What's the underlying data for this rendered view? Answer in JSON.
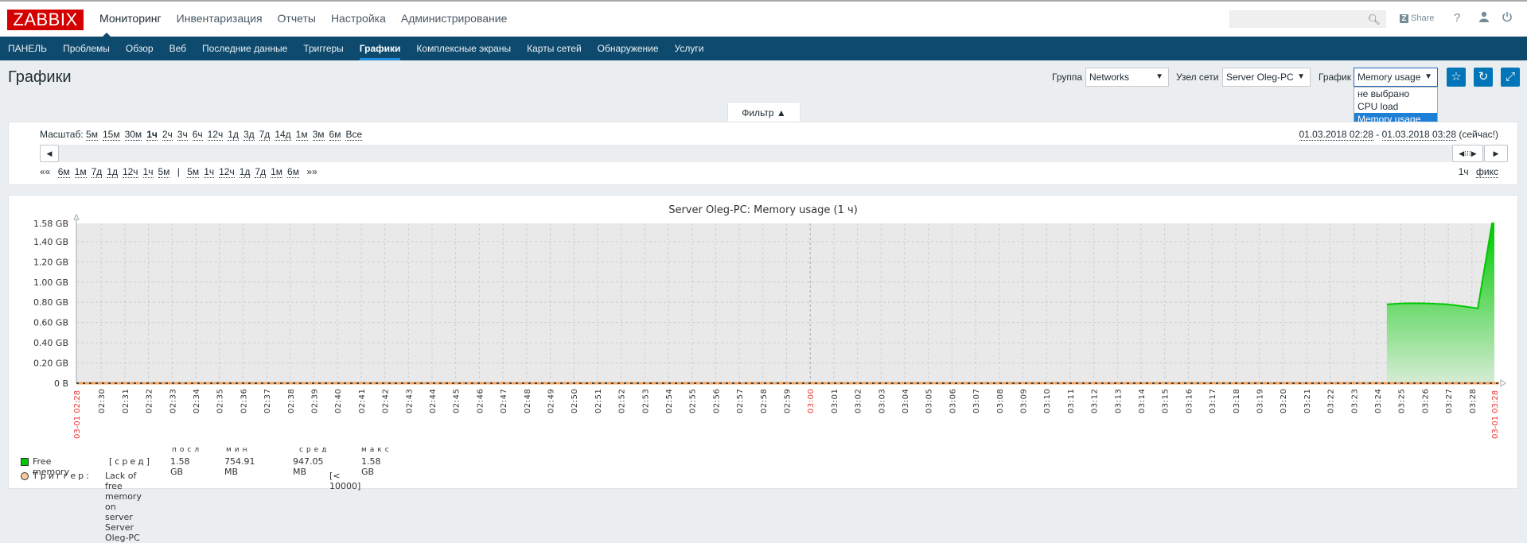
{
  "brand": "ZABBIX",
  "main_menu": [
    {
      "label": "Мониторинг",
      "active": true
    },
    {
      "label": "Инвентаризация",
      "active": false
    },
    {
      "label": "Отчеты",
      "active": false
    },
    {
      "label": "Настройка",
      "active": false
    },
    {
      "label": "Администрирование",
      "active": false
    }
  ],
  "header": {
    "search_placeholder": "",
    "share_label": "Share",
    "help_icon": "?",
    "user_icon": "user-icon",
    "logout_icon": "power-icon"
  },
  "sub_menu": [
    {
      "label": "ПАНЕЛЬ",
      "active": false
    },
    {
      "label": "Проблемы",
      "active": false
    },
    {
      "label": "Обзор",
      "active": false
    },
    {
      "label": "Веб",
      "active": false
    },
    {
      "label": "Последние данные",
      "active": false
    },
    {
      "label": "Триггеры",
      "active": false
    },
    {
      "label": "Графики",
      "active": true
    },
    {
      "label": "Комплексные экраны",
      "active": false
    },
    {
      "label": "Карты сетей",
      "active": false
    },
    {
      "label": "Обнаружение",
      "active": false
    },
    {
      "label": "Услуги",
      "active": false
    }
  ],
  "page_title": "Графики",
  "filters": {
    "group_label": "Группа",
    "group_value": "Networks",
    "host_label": "Узел сети",
    "host_value": "Server Oleg-PC",
    "graph_label": "График",
    "graph_value": "Memory usage",
    "graph_options": [
      "не выбрано",
      "CPU load",
      "Memory usage"
    ],
    "graph_selected_index": 2
  },
  "filter_tab": "Фильтр ▲",
  "timeline": {
    "zoom_label": "Масштаб:",
    "zoom_options": [
      "5м",
      "15м",
      "30м",
      "1ч",
      "2ч",
      "3ч",
      "6ч",
      "12ч",
      "1д",
      "3д",
      "7д",
      "14д",
      "1м",
      "3м",
      "6м",
      "Все"
    ],
    "zoom_active": "1ч",
    "period_from": "01.03.2018 02:28",
    "period_sep": " - ",
    "period_to": "01.03.2018 03:28",
    "period_note": "(сейчас!)",
    "back_links": [
      "6м",
      "1м",
      "7д",
      "1д",
      "12ч",
      "1ч",
      "5м"
    ],
    "fwd_links": [
      "5м",
      "1ч",
      "12ч",
      "1д",
      "7д",
      "1м",
      "6м"
    ],
    "back_arrow": "««",
    "fwd_arrow": "»»",
    "separator": "|",
    "period_length": "1ч",
    "fix_label": "фикс"
  },
  "chart_data": {
    "type": "area",
    "title": "Server Oleg-PC: Memory usage (1 ч)",
    "xlabel": "",
    "ylabel": "",
    "x_start_label": "03-01 02:28",
    "x_end_label": "03-01 03:28",
    "x_range_minutes": [
      0,
      60
    ],
    "x_tick_labels": [
      "02:30",
      "02:31",
      "02:32",
      "02:33",
      "02:34",
      "02:35",
      "02:36",
      "02:37",
      "02:38",
      "02:39",
      "02:40",
      "02:41",
      "02:42",
      "02:43",
      "02:44",
      "02:45",
      "02:46",
      "02:47",
      "02:48",
      "02:49",
      "02:50",
      "02:51",
      "02:52",
      "02:53",
      "02:54",
      "02:55",
      "02:56",
      "02:57",
      "02:58",
      "02:59",
      "03:00",
      "03:01",
      "03:02",
      "03:03",
      "03:04",
      "03:05",
      "03:06",
      "03:07",
      "03:08",
      "03:09",
      "03:10",
      "03:11",
      "03:12",
      "03:13",
      "03:14",
      "03:15",
      "03:16",
      "03:17",
      "03:18",
      "03:19",
      "03:20",
      "03:21",
      "03:22",
      "03:23",
      "03:24",
      "03:25",
      "03:26",
      "03:27",
      "03:28"
    ],
    "highlight_tick": "03:00",
    "y_tick_labels": [
      "0 B",
      "0.20 GB",
      "0.40 GB",
      "0.60 GB",
      "0.80 GB",
      "1.00 GB",
      "1.20 GB",
      "1.40 GB",
      "1.58 GB"
    ],
    "ylim": [
      0,
      1.58
    ],
    "grid": true,
    "series": [
      {
        "name": "Free memory",
        "unit": "GB",
        "color": "#00c800",
        "x_minutes": [
          55.45,
          56.2,
          57.0,
          58.0,
          58.7,
          59.3,
          59.9,
          60.0
        ],
        "values": [
          0.78,
          0.79,
          0.79,
          0.78,
          0.76,
          0.74,
          1.58,
          1.58
        ]
      }
    ],
    "trigger": {
      "name": "Lack of free memory on server Server Oleg-PC",
      "condition": "[< 10000]",
      "value": 10000,
      "color": "#f4a460"
    }
  },
  "legend": {
    "headers": [
      "посл",
      "мин",
      "сред",
      "макс"
    ],
    "rows": [
      {
        "name": "Free memory",
        "func": "[сред]",
        "last": "1.58 GB",
        "min": "754.91 MB",
        "avg": "947.05 MB",
        "max": "1.58 GB",
        "color": "#00c800"
      }
    ],
    "trigger_prefix": "Триггер:",
    "trigger_text": "Lack of free memory on server Server Oleg-PC",
    "trigger_cond": "[< 10000]"
  }
}
